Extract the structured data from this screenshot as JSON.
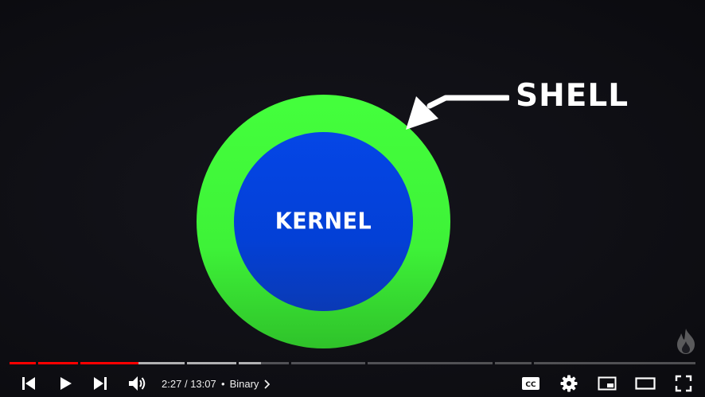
{
  "video": {
    "shell_label": "SHELL",
    "kernel_label": "KERNEL",
    "colors": {
      "shell": "#44ff3c",
      "kernel": "#0546e6",
      "background": "#0f0f14"
    }
  },
  "player": {
    "current_time": "2:27",
    "separator": "/",
    "duration": "13:07",
    "chapter_dot": "•",
    "chapter": "Binary",
    "progress_fraction": 0.187,
    "colors": {
      "played": "#ff0000",
      "track": "#5c5c60",
      "buffered": "#9a9a9e"
    },
    "icons": [
      "previous-icon",
      "play-icon",
      "next-icon",
      "volume-icon",
      "chevron-right-icon",
      "closed-captions-icon",
      "settings-icon",
      "miniplayer-icon",
      "theater-mode-icon",
      "fullscreen-icon",
      "flame-watermark-icon"
    ],
    "cc_label": "CC"
  }
}
